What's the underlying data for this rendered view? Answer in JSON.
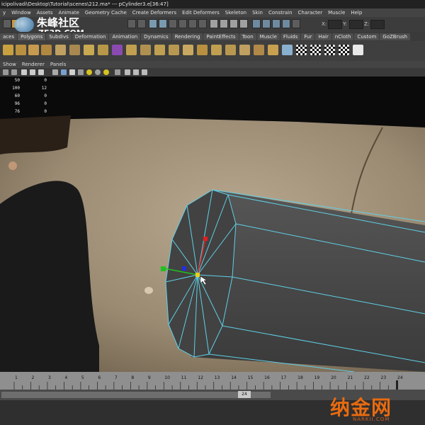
{
  "window": {
    "title": "icipolivadi\\Desktop\\Tutorial\\scenes\\212.ma*  ---  pCylinder3.e[36:47]"
  },
  "menu": [
    "y",
    "Window",
    "Assets",
    "Animate",
    "Geometry Cache",
    "Create Deformers",
    "Edit Deformers",
    "Skeleton",
    "Skin",
    "Constrain",
    "Character",
    "Muscle",
    "Help"
  ],
  "status": {
    "x_label": "X:",
    "y_label": "Y:",
    "z_label": "Z:"
  },
  "shelf_tabs": [
    "aces",
    "Polygons",
    "Subdivs",
    "Deformation",
    "Animation",
    "Dynamics",
    "Rendering",
    "PaintEffects",
    "Toon",
    "Muscle",
    "Fluids",
    "Fur",
    "Hair",
    "nCloth",
    "Custom",
    "GoZBrush"
  ],
  "panel_menu": [
    "Show",
    "Renderer",
    "Panels"
  ],
  "hud": {
    "rows": [
      {
        "a": "50",
        "b": "0"
      },
      {
        "a": "100",
        "b": "12"
      },
      {
        "a": "60",
        "b": "0"
      },
      {
        "a": "96",
        "b": "0"
      },
      {
        "a": "76",
        "b": "0"
      }
    ]
  },
  "timeline": {
    "ticks": [
      "1",
      "2",
      "3",
      "4",
      "5",
      "6",
      "7",
      "8",
      "9",
      "10",
      "11",
      "12",
      "13",
      "14",
      "15",
      "16",
      "17",
      "18",
      "19",
      "20",
      "21",
      "22",
      "23",
      "24"
    ],
    "current_frame": "24"
  },
  "watermarks": {
    "top_cn": "朱峰社区",
    "top_en": "ZF3D.COM",
    "bottom_cn": "纳金网",
    "bottom_en": "NARKII.COM"
  },
  "colors": {
    "wireframe": "#5fd0e6",
    "mesh": "#4a4a4a",
    "manip_red": "#e02020",
    "manip_green": "#20c020",
    "manip_blue": "#2030e0",
    "manip_center": "#e8d020",
    "watermark_orange": "#e86b10"
  },
  "icons": [
    "cube-icon",
    "sphere-icon",
    "cylinder-icon",
    "torus-icon",
    "plane-icon",
    "extrude-icon",
    "bevel-icon",
    "split-icon",
    "merge-icon",
    "smooth-icon",
    "uv-icon",
    "checker-icon"
  ]
}
